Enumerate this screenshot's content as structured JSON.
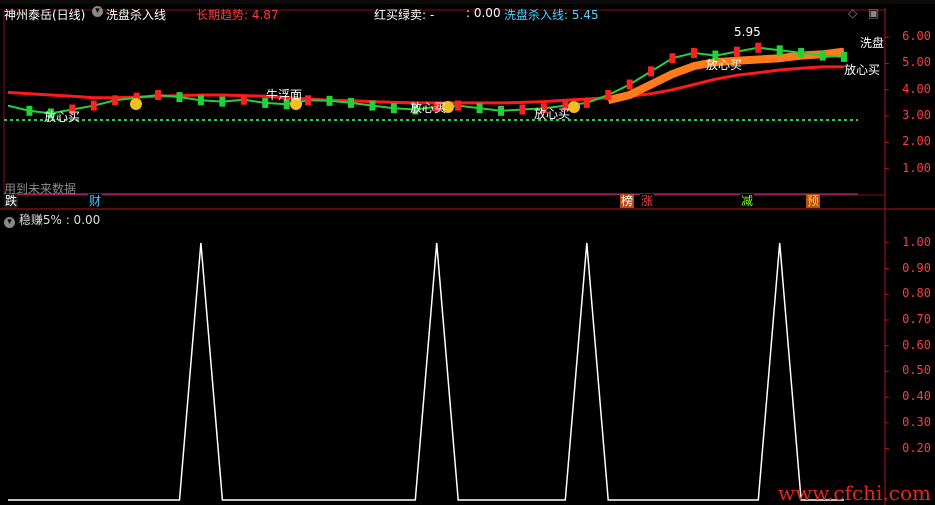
{
  "header": {
    "stock_name": "神州泰岳(日线)",
    "indicator_name": "洗盘杀入线",
    "long_trend_label": "长期趋势: 4.87",
    "redbuy_label": "红买绿卖: -",
    "redbuy_value": ": 0.00",
    "xipan_label": "洗盘杀入线: 5.45"
  },
  "upper_axis": {
    "ticks": [
      "6.00",
      "5.00",
      "4.00",
      "3.00",
      "2.00",
      "1.00"
    ]
  },
  "annotations": {
    "peak_price": "5.95",
    "xipan_tag": "洗盘",
    "buy_label": "放心买",
    "niu_label": "牛浮面",
    "future_note": "用到未来数据"
  },
  "signals": [
    {
      "text": "跌",
      "color": "#ffffff",
      "bg": "#1a1a1a"
    },
    {
      "text": "财",
      "color": "#4fc3ff",
      "bg": "#000000"
    },
    {
      "text": "榜",
      "color": "#ffffff",
      "bg": "#b84a1a"
    },
    {
      "text": "涨",
      "color": "#ff3b3b",
      "bg": "#000000"
    },
    {
      "text": "减",
      "color": "#7fff3a",
      "bg": "#000000"
    },
    {
      "text": "预",
      "color": "#ffd400",
      "bg": "#b84a1a"
    }
  ],
  "lower_panel": {
    "title": "稳赚5%",
    "value": ": 0.00",
    "ticks": [
      "1.00",
      "0.90",
      "0.80",
      "0.70",
      "0.60",
      "0.50",
      "0.40",
      "0.30",
      "0.20"
    ]
  },
  "watermark": "www.cfchi.com",
  "chart_data": [
    {
      "type": "line",
      "name": "upper",
      "y_axis_ticks": [
        6.0,
        5.0,
        4.0,
        3.0,
        2.0,
        1.0
      ],
      "ylim": [
        0.0,
        6.5
      ],
      "series": [
        {
          "name": "长期趋势",
          "color": "#ff1a1a",
          "values": [
            3.9,
            3.85,
            3.8,
            3.75,
            3.7,
            3.7,
            3.72,
            3.75,
            3.78,
            3.8,
            3.8,
            3.78,
            3.75,
            3.7,
            3.65,
            3.6,
            3.58,
            3.55,
            3.52,
            3.5,
            3.5,
            3.5,
            3.5,
            3.5,
            3.52,
            3.55,
            3.6,
            3.65,
            3.7,
            3.75,
            3.85,
            4.0,
            4.2,
            4.4,
            4.55,
            4.65,
            4.75,
            4.82,
            4.87,
            4.87
          ]
        },
        {
          "name": "洗盘杀入线",
          "color": "#ff7a1a",
          "values": [
            null,
            null,
            null,
            null,
            null,
            null,
            null,
            null,
            null,
            null,
            null,
            null,
            null,
            null,
            null,
            null,
            null,
            null,
            null,
            null,
            null,
            null,
            null,
            null,
            null,
            null,
            null,
            null,
            3.6,
            3.8,
            4.2,
            4.6,
            4.9,
            5.05,
            5.1,
            5.15,
            5.2,
            5.3,
            5.35,
            5.45
          ]
        },
        {
          "name": "红买绿卖",
          "color": "#22d13a",
          "values": [
            3.4,
            3.2,
            3.1,
            3.25,
            3.4,
            3.6,
            3.7,
            3.8,
            3.72,
            3.6,
            3.55,
            3.62,
            3.5,
            3.45,
            3.6,
            3.58,
            3.5,
            3.4,
            3.3,
            3.25,
            3.35,
            3.4,
            3.3,
            3.2,
            3.25,
            3.3,
            3.4,
            3.5,
            3.8,
            4.2,
            4.7,
            5.2,
            5.4,
            5.3,
            5.45,
            5.6,
            5.5,
            5.4,
            5.3,
            5.25
          ]
        }
      ]
    },
    {
      "type": "line",
      "name": "稳赚5%",
      "y_axis_ticks": [
        1.0,
        0.9,
        0.8,
        0.7,
        0.6,
        0.5,
        0.4,
        0.3,
        0.2
      ],
      "ylim": [
        0,
        1.05
      ],
      "series": [
        {
          "name": "稳赚5%",
          "color": "#ffffff",
          "values": [
            0,
            0,
            0,
            0,
            0,
            0,
            0,
            0,
            0,
            1,
            0,
            0,
            0,
            0,
            0,
            0,
            0,
            0,
            0,
            0,
            1,
            0,
            0,
            0,
            0,
            0,
            0,
            1,
            0,
            0,
            0,
            0,
            0,
            0,
            0,
            0,
            1,
            0,
            0,
            0
          ]
        }
      ]
    }
  ]
}
